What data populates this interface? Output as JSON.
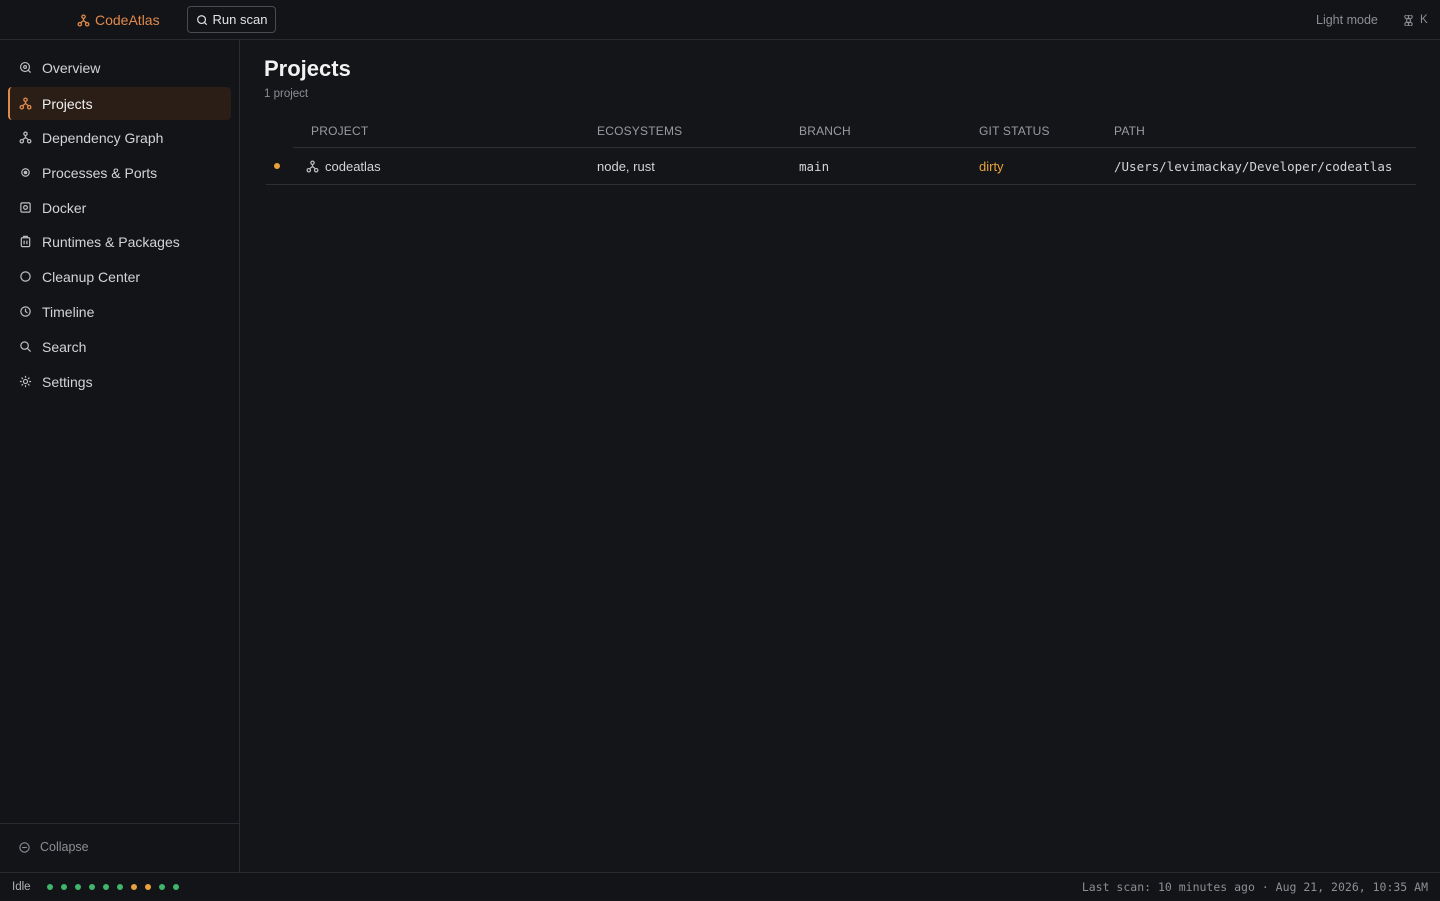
{
  "app": {
    "name": "CodeAtlas",
    "accent_color": "#e0894a"
  },
  "topbar": {
    "run_scan_label": "Run scan",
    "theme_toggle_label": "Light mode",
    "shortcut_key": "K"
  },
  "sidebar": {
    "items": [
      {
        "label": "Overview",
        "icon": "overview-icon",
        "active": false
      },
      {
        "label": "Projects",
        "icon": "projects-icon",
        "active": true
      },
      {
        "label": "Dependency Graph",
        "icon": "graph-icon",
        "active": false
      },
      {
        "label": "Processes & Ports",
        "icon": "processes-icon",
        "active": false
      },
      {
        "label": "Docker",
        "icon": "docker-icon",
        "active": false
      },
      {
        "label": "Runtimes & Packages",
        "icon": "package-icon",
        "active": false
      },
      {
        "label": "Cleanup Center",
        "icon": "cleanup-icon",
        "active": false
      },
      {
        "label": "Timeline",
        "icon": "clock-icon",
        "active": false
      },
      {
        "label": "Search",
        "icon": "search-icon",
        "active": false
      },
      {
        "label": "Settings",
        "icon": "gear-icon",
        "active": false
      }
    ],
    "collapse_label": "Collapse"
  },
  "main": {
    "title": "Projects",
    "subtitle": "1 project",
    "table": {
      "headers": [
        "PROJECT",
        "ECOSYSTEMS",
        "BRANCH",
        "GIT STATUS",
        "PATH"
      ],
      "rows": [
        {
          "project": "codeatlas",
          "ecosystems": "node, rust",
          "branch": "main",
          "git_status": "dirty",
          "git_status_color": "#e9a23b",
          "path": "/Users/levimackay/Developer/codeatlas"
        }
      ]
    }
  },
  "statusbar": {
    "state": "Idle",
    "indicator_colors": [
      "#3fb66b",
      "#3fb66b",
      "#3fb66b",
      "#3fb66b",
      "#3fb66b",
      "#3fb66b",
      "#e9a23b",
      "#e9a23b",
      "#3fb66b",
      "#3fb66b"
    ],
    "last_scan": "Last scan: 10 minutes ago · Aug 21, 2026, 10:35 AM"
  }
}
